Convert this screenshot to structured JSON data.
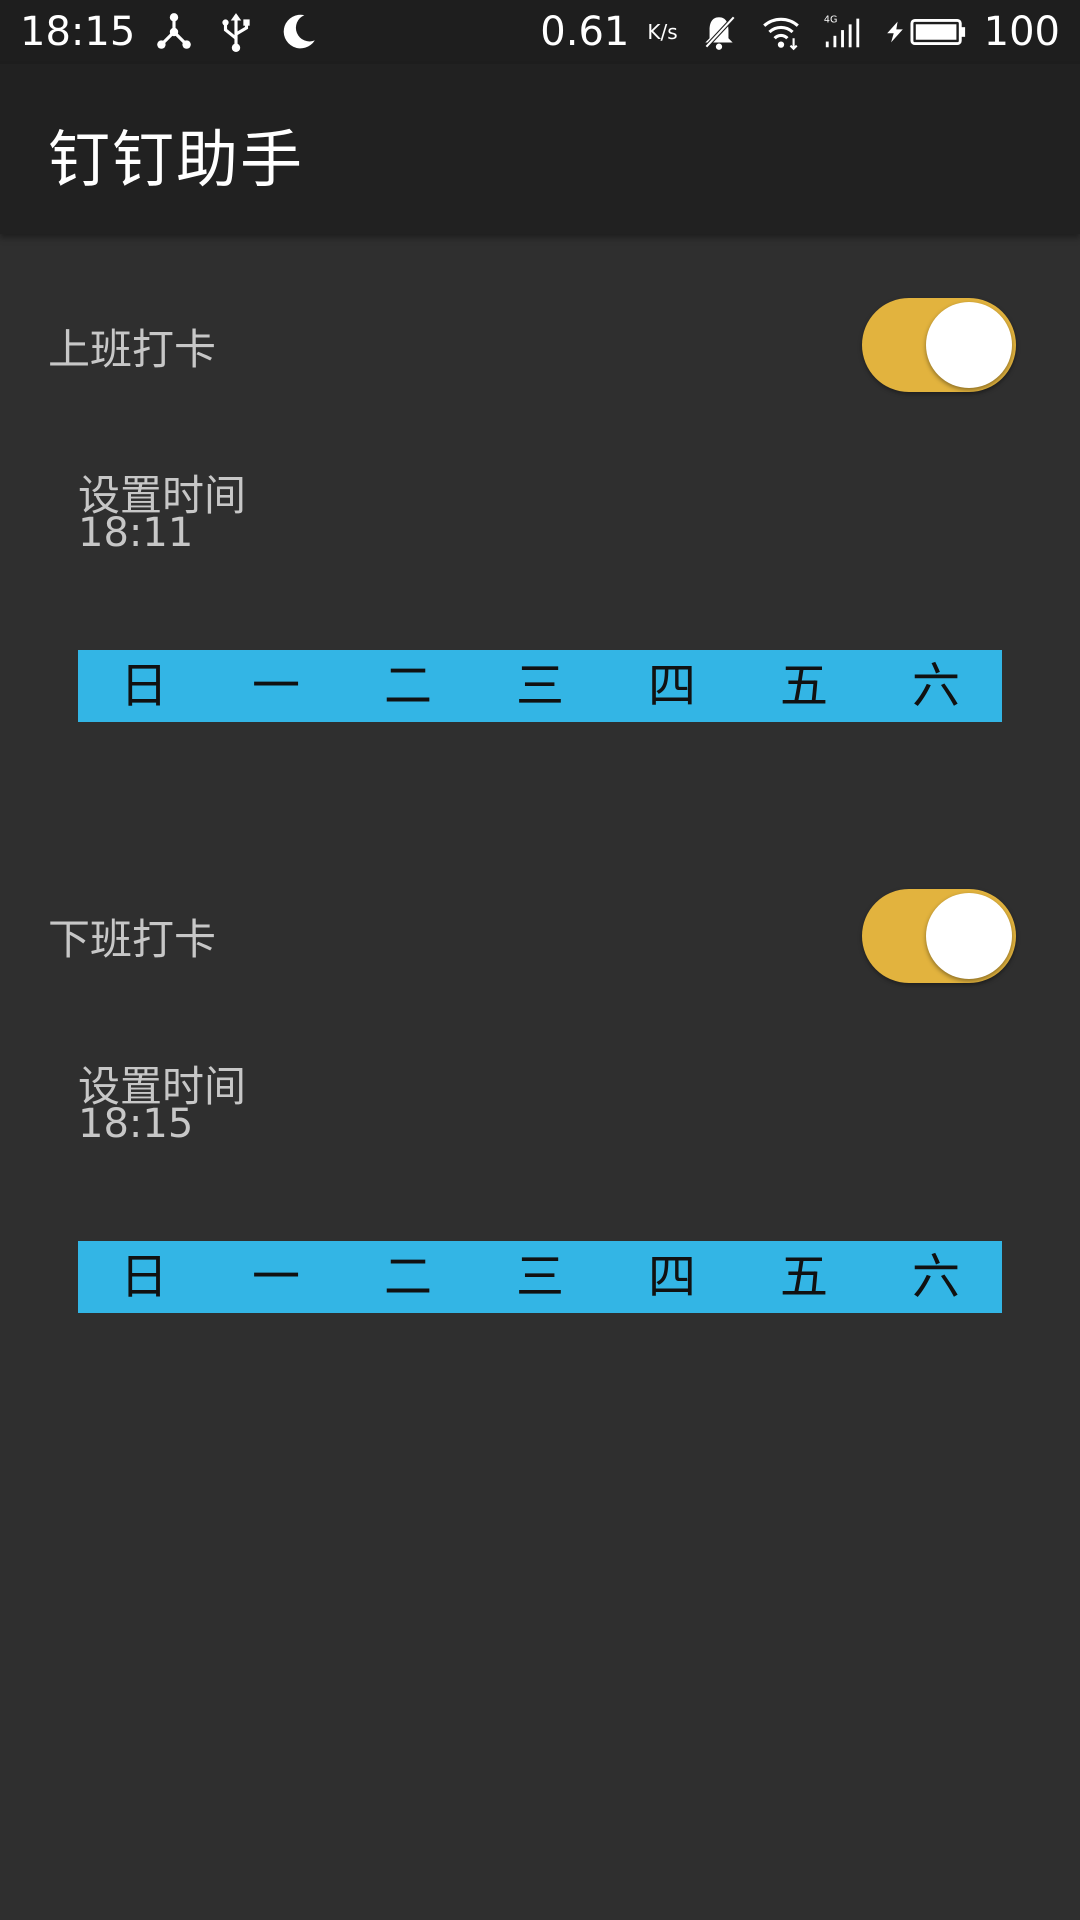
{
  "status_bar": {
    "time": "18:15",
    "speed": "0.61",
    "speed_unit": "K/s",
    "network": "4G",
    "battery": "100",
    "icons": [
      "share-hub-icon",
      "usb-icon",
      "moon-icon",
      "mute-bell-icon",
      "wifi-icon",
      "signal-icon",
      "charging-icon",
      "battery-icon"
    ]
  },
  "app_bar": {
    "title": "钉钉助手"
  },
  "sections": [
    {
      "title": "上班打卡",
      "toggle_on": true,
      "time_label": "设置时间",
      "time_value": "18:11",
      "days": [
        "日",
        "一",
        "二",
        "三",
        "四",
        "五",
        "六"
      ]
    },
    {
      "title": "下班打卡",
      "toggle_on": true,
      "time_label": "设置时间",
      "time_value": "18:15",
      "days": [
        "日",
        "一",
        "二",
        "三",
        "四",
        "五",
        "六"
      ]
    }
  ],
  "colors": {
    "toggle_on": "#e2b33e",
    "weekday_bar": "#33b5e5",
    "background": "#2f2f2f",
    "app_bar": "#212121"
  }
}
